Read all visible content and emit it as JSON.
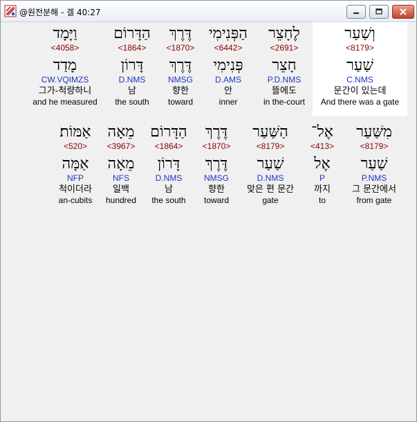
{
  "window": {
    "title": "@원전분해 - 겔 40:27"
  },
  "row1": [
    {
      "hebrew": "וְשַׁעַר",
      "strong": "<8179>",
      "lemma": "שַׁעַר",
      "morph": "C.NMS",
      "korean": "문간이 있는데",
      "english": "And there was a gate"
    },
    {
      "hebrew": "לֶחָצֵר",
      "strong": "<2691>",
      "lemma": "חָצֵר",
      "morph": "P.D.NMS",
      "korean": "뜰에도",
      "english": "in the-court"
    },
    {
      "hebrew": "הַפְּנִימִי",
      "strong": "<6442>",
      "lemma": "פְּנִימִי",
      "morph": "D.AMS",
      "korean": "안",
      "english": "inner"
    },
    {
      "hebrew": "דֶּרֶךְ",
      "strong": "<1870>",
      "lemma": "דֶּרֶךְ",
      "morph": "NMSG",
      "korean": "향한",
      "english": "toward"
    },
    {
      "hebrew": "הַדָּרוֹם",
      "strong": "<1864>",
      "lemma": "דָּרוֹן",
      "morph": "D.NMS",
      "korean": "남",
      "english": "the south"
    },
    {
      "hebrew": "וַיָּמָד",
      "strong": "<4058>",
      "lemma": "מָדַד",
      "morph": "CW.VQIMZS",
      "korean": "그가-척량하니",
      "english": "and he measured"
    }
  ],
  "row2": [
    {
      "hebrew": "מִשַּׁעַר",
      "strong": "<8179>",
      "lemma": "שַׁעַר",
      "morph": "P.NMS",
      "korean": "그 문간에서",
      "english": "from gate"
    },
    {
      "hebrew": "אֶל־",
      "strong": "<413>",
      "lemma": "אֶל",
      "morph": "P",
      "korean": "까지",
      "english": "to"
    },
    {
      "hebrew": "הַשַּׁעַר",
      "strong": "<8179>",
      "lemma": "שַׁעַר",
      "morph": "D.NMS",
      "korean": "맞은 편 문간",
      "english": "gate"
    },
    {
      "hebrew": "דֶּרֶךְ",
      "strong": "<1870>",
      "lemma": "דֶּרֶךְ",
      "morph": "NMSG",
      "korean": "향한",
      "english": "toward"
    },
    {
      "hebrew": "הַדָּרוֹם",
      "strong": "<1864>",
      "lemma": "דָּרוֹן",
      "morph": "D.NMS",
      "korean": "남",
      "english": "the south"
    },
    {
      "hebrew": "מֵאָה",
      "strong": "<3967>",
      "lemma": "מֵאָה",
      "morph": "NFS",
      "korean": "일백",
      "english": "hundred"
    },
    {
      "hebrew": "אַמּוֹת׃",
      "strong": "<520>",
      "lemma": "אַמָּה",
      "morph": "NFP",
      "korean": "척이더라",
      "english": "an-cubits"
    }
  ]
}
